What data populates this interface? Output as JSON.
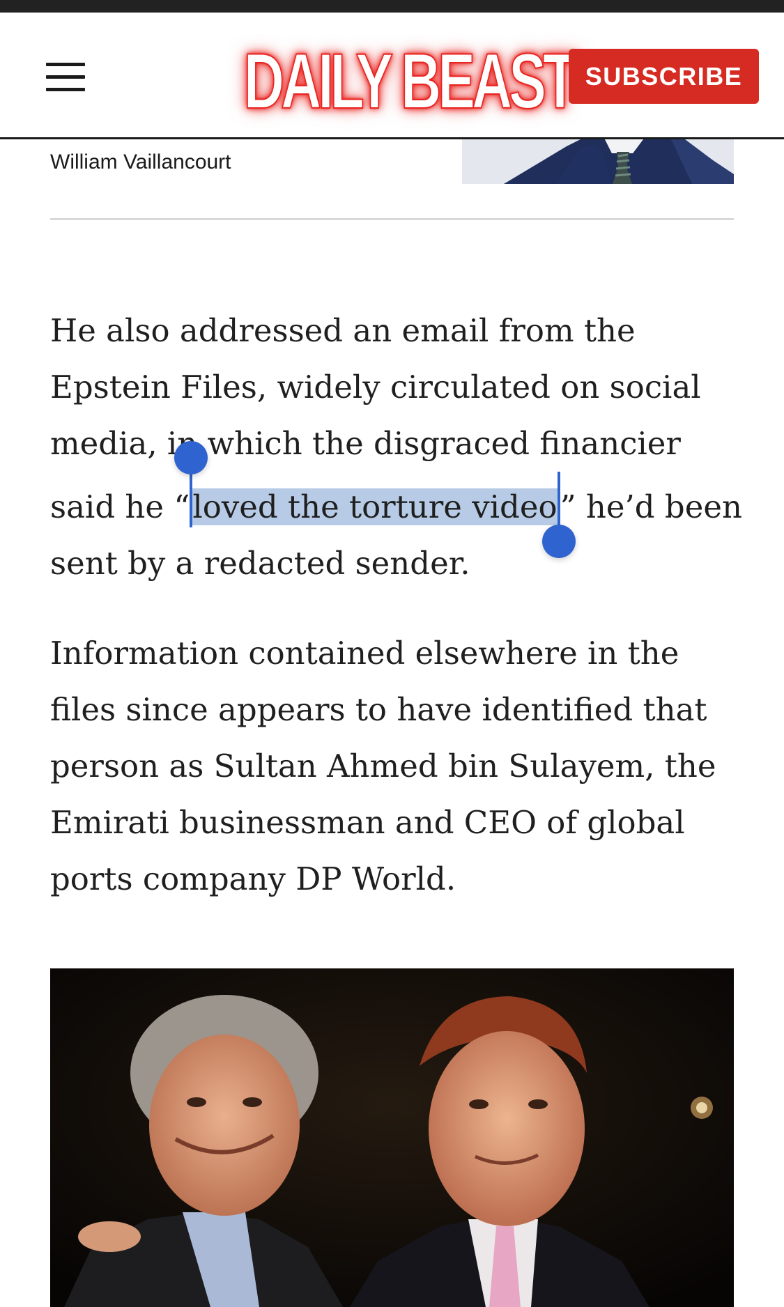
{
  "header": {
    "logo_text": "DAILY BEAST",
    "subscribe_label": "SUBSCRIBE",
    "menu_icon": "hamburger-menu-icon",
    "brand_color": "#d62b22"
  },
  "byline": {
    "author": "William Vaillancourt"
  },
  "article": {
    "paragraph1": {
      "line1": "He also addressed an email from the",
      "line2": "Epstein Files, widely circulated on social",
      "line3_before": "media, i",
      "line3_after": "n which the disgraced financier",
      "line4_before": "said he “",
      "line4_selected": "loved the torture video",
      "line4_after": "” he’d been",
      "line5": "sent by a redacted sender."
    },
    "paragraph2": {
      "line1": "Information contained elsewhere in the",
      "line2": "files since appears to have identified that",
      "line3": "person as Sultan Ahmed bin Sulayem, the",
      "line4": "Emirati businessman and CEO of global",
      "line5": "ports company DP World."
    }
  },
  "selection": {
    "highlight_color": "#b7cbe6",
    "handle_color": "#2f63cf"
  }
}
